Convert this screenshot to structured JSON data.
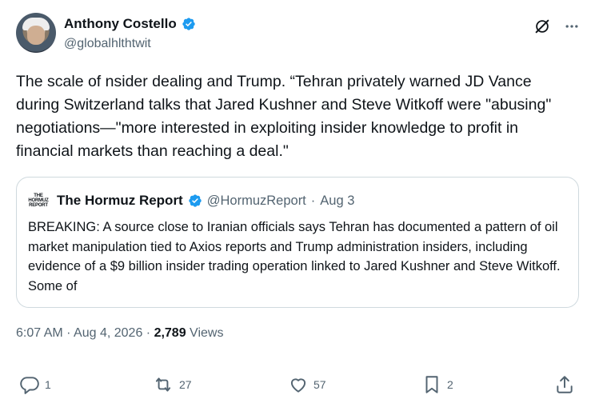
{
  "author": {
    "name": "Anthony Costello",
    "handle": "@globalhlthtwit"
  },
  "tweet": {
    "text": "The scale of nsider dealing and Trump. “Tehran privately warned JD Vance during Switzerland talks that Jared Kushner and Steve Witkoff were \"abusing\" negotiations—\"more interested in exploiting insider knowledge to profit in financial markets than reaching a deal.\""
  },
  "quote": {
    "logo_lines": [
      "THE",
      "HORMUZ",
      "REPORT"
    ],
    "name": "The Hormuz Report",
    "handle": "@HormuzReport",
    "separator": "·",
    "date": "Aug 3",
    "text": "BREAKING: A source close to Iranian officials says Tehran has documented a pattern of oil market manipulation tied to Axios reports and Trump administration insiders, including evidence of a $9 billion insider trading operation linked to Jared Kushner and Steve Witkoff. Some of"
  },
  "meta": {
    "time": "6:07 AM",
    "sep1": " · ",
    "date": "Aug 4, 2026",
    "sep2": " · ",
    "views_count": "2,789",
    "views_label": " Views"
  },
  "actions": {
    "replies": "1",
    "reposts": "27",
    "likes": "57",
    "bookmarks": "2"
  },
  "colors": {
    "verified": "#1d9bf0",
    "text": "#0f1419",
    "secondary": "#536471",
    "border": "#cfd9de"
  },
  "icons": [
    "verified-badge-icon",
    "grok-icon",
    "more-icon",
    "reply-icon",
    "repost-icon",
    "like-icon",
    "bookmark-icon",
    "share-icon"
  ]
}
